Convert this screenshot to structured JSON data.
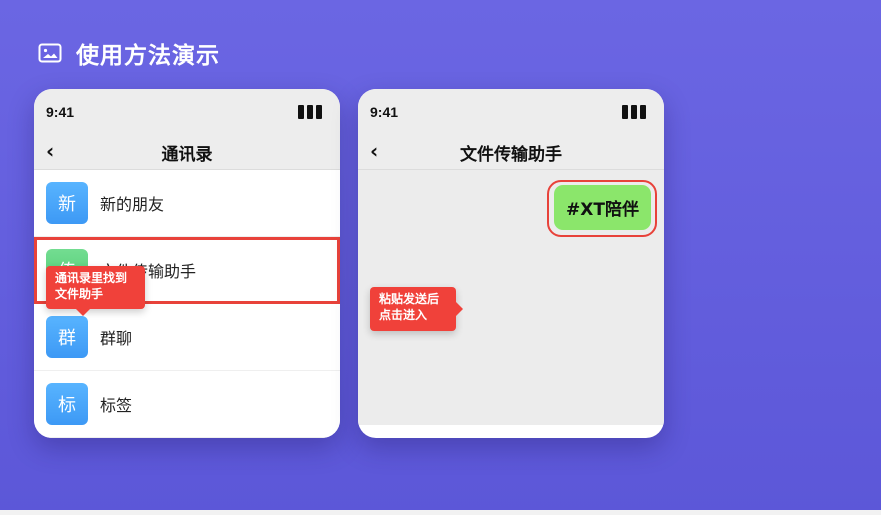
{
  "header": {
    "title": "使用方法演示",
    "icon": "image-icon"
  },
  "phone_left": {
    "status": {
      "time": "9:41"
    },
    "nav": {
      "back": "‹",
      "title": "通讯录"
    },
    "items": [
      {
        "avatar": "新",
        "label": "新的朋友",
        "avatar_color": "#4aa7fb"
      },
      {
        "avatar": "传",
        "label": "文件传输助手",
        "avatar_color": "#5fd181"
      },
      {
        "avatar": "群",
        "label": "群聊",
        "avatar_color": "#4aa7fb"
      },
      {
        "avatar": "标",
        "label": "标签",
        "avatar_color": "#4aa7fb"
      }
    ],
    "tooltip": {
      "line1": "通讯录里找到",
      "line2": "文件助手"
    }
  },
  "phone_right": {
    "status": {
      "time": "9:41"
    },
    "nav": {
      "back": "‹",
      "title": "文件传输助手"
    },
    "message": "#XT陪伴",
    "tooltip": {
      "line1": "粘贴发送后",
      "line2": "点击进入"
    }
  },
  "colors": {
    "background": "#6560dd",
    "highlight": "#e8423a",
    "bubble": "#8be66b"
  }
}
